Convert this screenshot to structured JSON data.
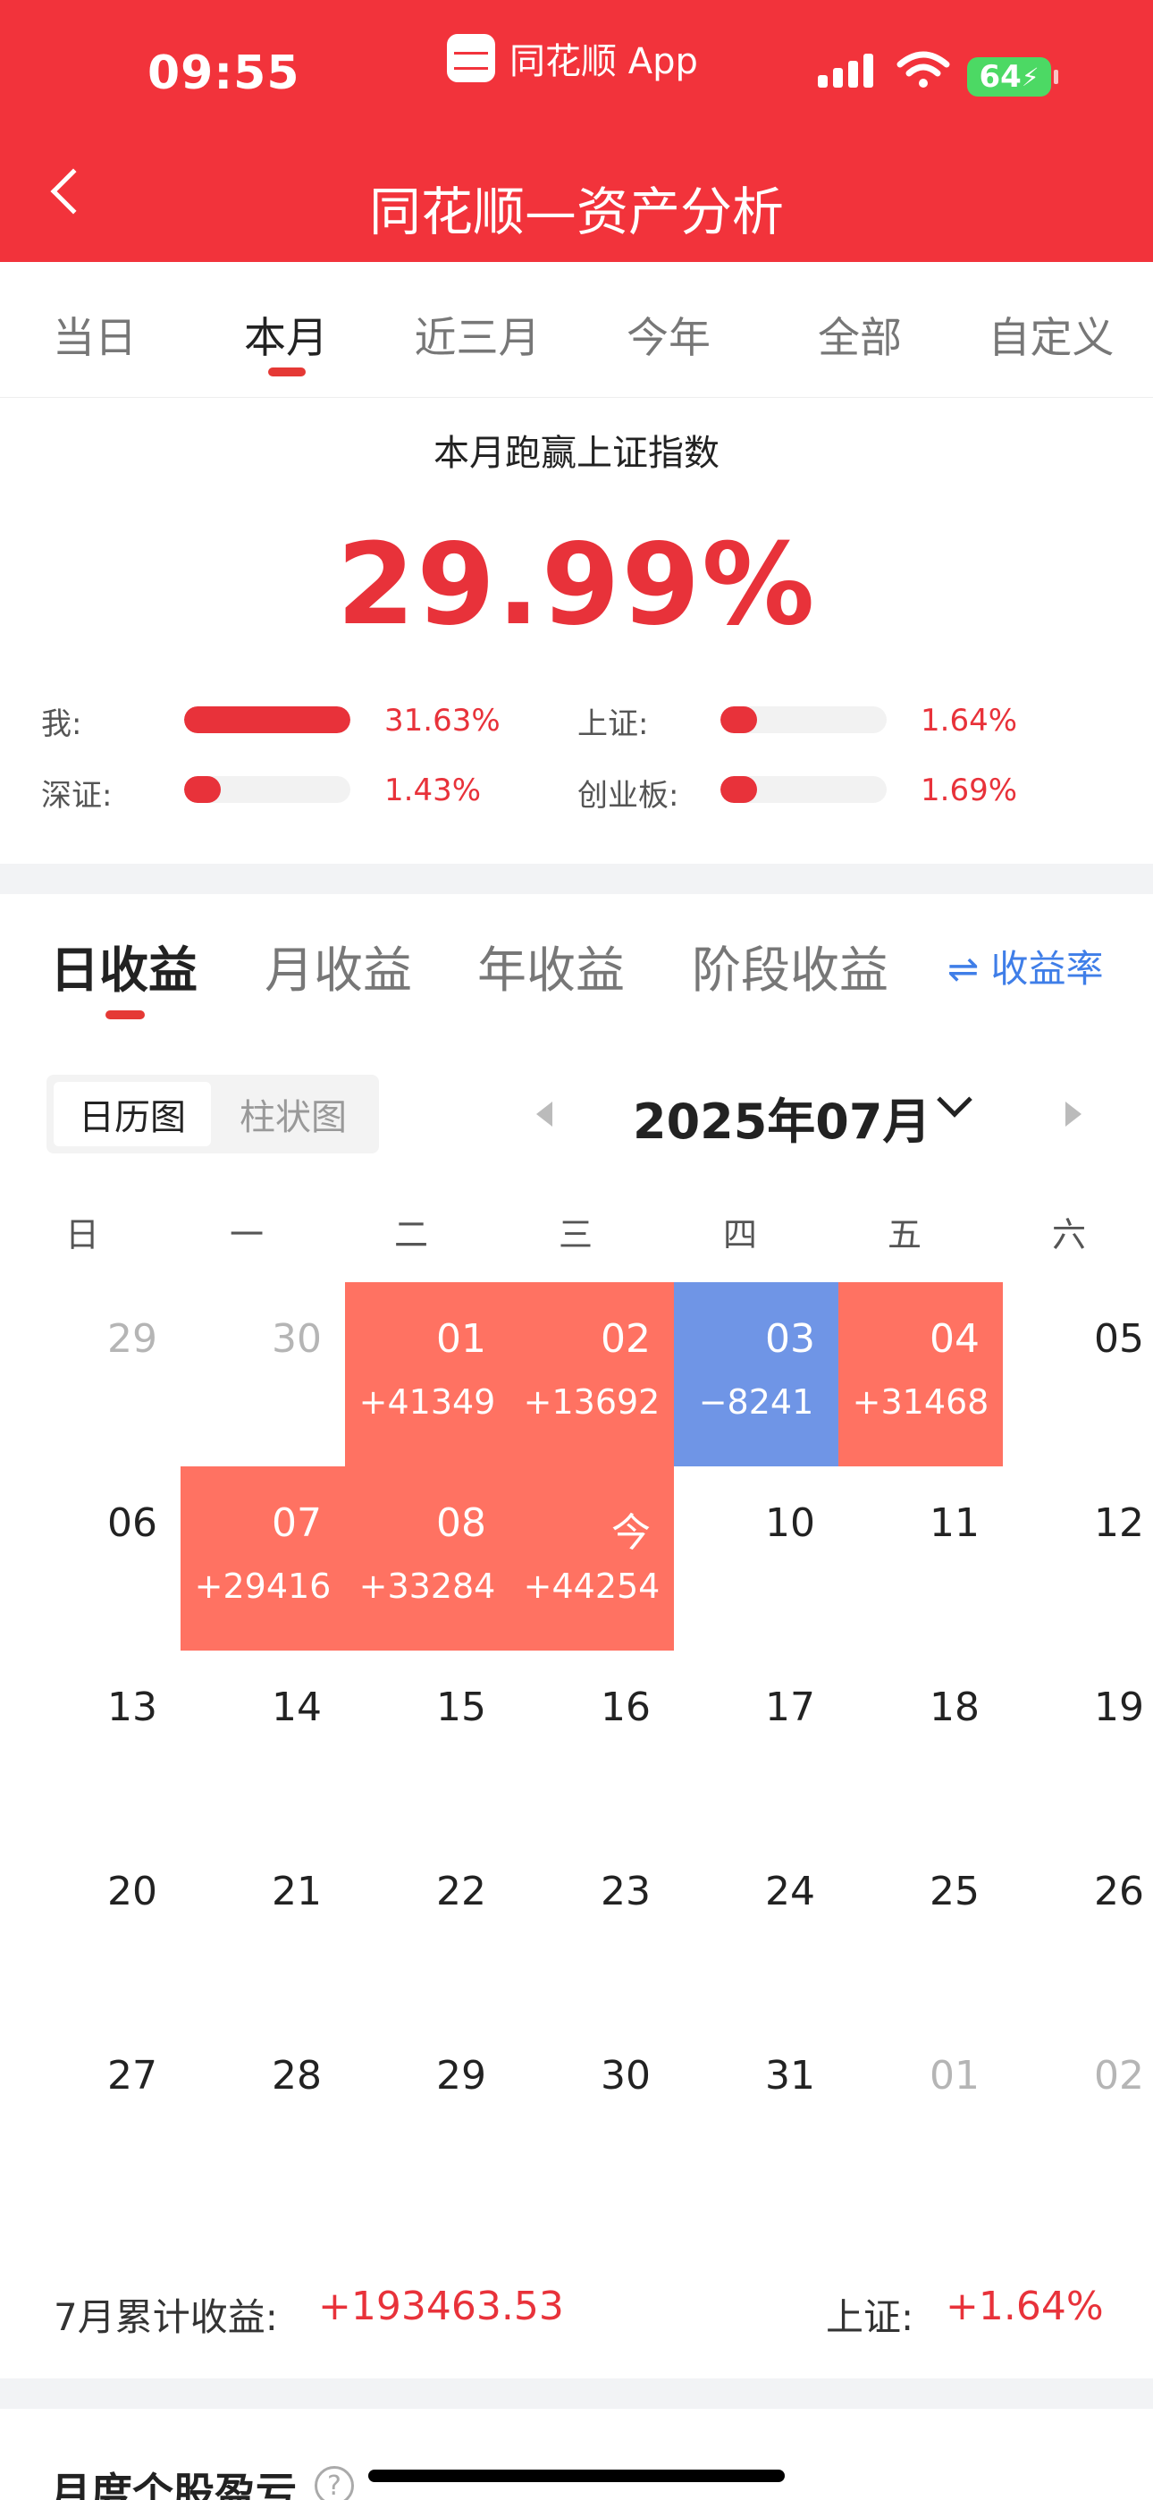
{
  "status_bar": {
    "time": "09:55",
    "app_name": "同花顺 App",
    "battery": "64",
    "icons": [
      "signal-icon",
      "wifi-icon",
      "battery-icon"
    ]
  },
  "header": {
    "title": "同花顺—资产分析",
    "back_icon": "chevron-left-icon",
    "background_color": "#f2333b"
  },
  "period_tabs": [
    {
      "label": "当日",
      "active": false
    },
    {
      "label": "本月",
      "active": true
    },
    {
      "label": "近三月",
      "active": false
    },
    {
      "label": "今年",
      "active": false
    },
    {
      "label": "全部",
      "active": false
    },
    {
      "label": "自定义",
      "active": false
    }
  ],
  "summary": {
    "title": "本月跑赢上证指数",
    "value": "29.99%",
    "comparisons": [
      {
        "label": "我:",
        "value": "31.63%",
        "fill": 1.0
      },
      {
        "label": "上证:",
        "value": "1.64%",
        "fill": 0.05
      },
      {
        "label": "深证:",
        "value": "1.43%",
        "fill": 0.045
      },
      {
        "label": "创业板:",
        "value": "1.69%",
        "fill": 0.053
      }
    ]
  },
  "income_tabs": [
    {
      "label": "日收益",
      "active": true
    },
    {
      "label": "月收益",
      "active": false
    },
    {
      "label": "年收益",
      "active": false
    },
    {
      "label": "阶段收益",
      "active": false
    }
  ],
  "rate_toggle": "⇌ 收益率",
  "view_toggle": {
    "calendar": "日历图",
    "bar": "柱状图",
    "active": "calendar"
  },
  "month_nav": {
    "label": "2025年07月"
  },
  "calendar": {
    "weekdays": [
      "日",
      "一",
      "二",
      "三",
      "四",
      "五",
      "六"
    ],
    "weeks": [
      [
        {
          "day": "29",
          "type": "other"
        },
        {
          "day": "30",
          "type": "other"
        },
        {
          "day": "01",
          "type": "gain",
          "value": "+41349"
        },
        {
          "day": "02",
          "type": "gain",
          "value": "+13692"
        },
        {
          "day": "03",
          "type": "loss",
          "value": "−8241"
        },
        {
          "day": "04",
          "type": "gain",
          "value": "+31468"
        },
        {
          "day": "05",
          "type": "normal"
        }
      ],
      [
        {
          "day": "06",
          "type": "normal"
        },
        {
          "day": "07",
          "type": "gain",
          "value": "+29416"
        },
        {
          "day": "08",
          "type": "gain",
          "value": "+33284"
        },
        {
          "day": "今",
          "type": "gain",
          "value": "+44254"
        },
        {
          "day": "10",
          "type": "normal"
        },
        {
          "day": "11",
          "type": "normal"
        },
        {
          "day": "12",
          "type": "normal"
        }
      ],
      [
        {
          "day": "13",
          "type": "normal"
        },
        {
          "day": "14",
          "type": "normal"
        },
        {
          "day": "15",
          "type": "normal"
        },
        {
          "day": "16",
          "type": "normal"
        },
        {
          "day": "17",
          "type": "normal"
        },
        {
          "day": "18",
          "type": "normal"
        },
        {
          "day": "19",
          "type": "normal"
        }
      ],
      [
        {
          "day": "20",
          "type": "normal"
        },
        {
          "day": "21",
          "type": "normal"
        },
        {
          "day": "22",
          "type": "normal"
        },
        {
          "day": "23",
          "type": "normal"
        },
        {
          "day": "24",
          "type": "normal"
        },
        {
          "day": "25",
          "type": "normal"
        },
        {
          "day": "26",
          "type": "normal"
        }
      ],
      [
        {
          "day": "27",
          "type": "normal"
        },
        {
          "day": "28",
          "type": "normal"
        },
        {
          "day": "29",
          "type": "normal"
        },
        {
          "day": "30",
          "type": "normal"
        },
        {
          "day": "31",
          "type": "normal"
        },
        {
          "day": "01",
          "type": "other"
        },
        {
          "day": "02",
          "type": "other"
        }
      ]
    ],
    "colors": {
      "gain": "#ff7262",
      "loss": "#6f95e6"
    }
  },
  "footer": {
    "cumulative_label": "7月累计收益:",
    "cumulative_value": "+193463.53",
    "index_label": "上证:",
    "index_value": "+1.64%"
  },
  "next_section": {
    "title": "月度个股盈亏",
    "help_icon": "?"
  }
}
